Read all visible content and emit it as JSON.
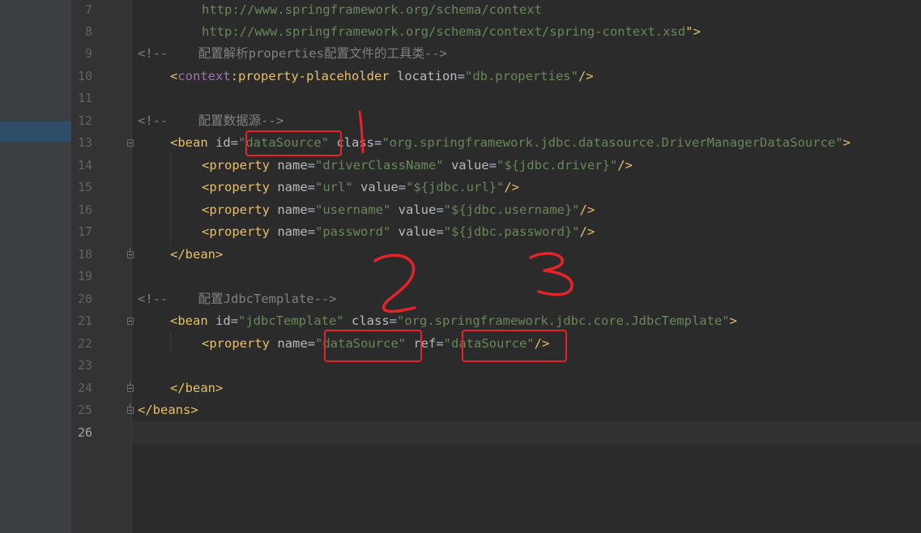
{
  "line_numbers": [
    "7",
    "8",
    "9",
    "10",
    "11",
    "12",
    "13",
    "14",
    "15",
    "16",
    "17",
    "18",
    "19",
    "20",
    "21",
    "22",
    "23",
    "24",
    "25",
    "26"
  ],
  "current_line": "26",
  "code": {
    "l7_value": "http://www.springframework.org/schema/context",
    "l8_value": "http://www.springframework.org/schema/context/spring-context.xsd",
    "l8_close": "\">",
    "l9_comment": "<!--    配置解析properties配置文件的工具类-->",
    "l10_open": "<",
    "l10_ns": "context",
    "l10_tag": ":property-placeholder ",
    "l10_attr": "location",
    "l10_eq": "=",
    "l10_val": "\"db.properties\"",
    "l10_close": "/>",
    "l12_comment": "<!--    配置数据源-->",
    "l13_tag": "<bean ",
    "l13_attr1": "id",
    "l13_eq1": "=",
    "l13_val1": "\"dataSource\"",
    "l13_attr2": " class",
    "l13_eq2": "=",
    "l13_val2": "\"org.springframework.jdbc.datasource.DriverManagerDataSource\"",
    "l13_close": ">",
    "props": [
      {
        "tag": "<property ",
        "a1": "name",
        "v1": "\"driverClassName\"",
        "a2": " value",
        "v2": "\"${jdbc.driver}\"",
        "close": "/>"
      },
      {
        "tag": "<property ",
        "a1": "name",
        "v1": "\"url\"",
        "a2": " value",
        "v2": "\"${jdbc.url}\"",
        "close": "/>"
      },
      {
        "tag": "<property ",
        "a1": "name",
        "v1": "\"username\"",
        "a2": " value",
        "v2": "\"${jdbc.username}\"",
        "close": "/>"
      },
      {
        "tag": "<property ",
        "a1": "name",
        "v1": "\"password\"",
        "a2": " value",
        "v2": "\"${jdbc.password}\"",
        "close": "/>"
      }
    ],
    "eq": "=",
    "l18_close": "</bean>",
    "l20_comment": "<!--    配置JdbcTemplate-->",
    "l21_tag": "<bean ",
    "l21_attr1": "id",
    "l21_val1": "\"jdbcTemplate\"",
    "l21_attr2": " class",
    "l21_val2": "\"org.springframework.jdbc.core.JdbcTemplate\"",
    "l21_close": ">",
    "l22_tag": "<property ",
    "l22_attr1": "name",
    "l22_val1": "\"dataSource\"",
    "l22_attr2": " ref",
    "l22_val2": "\"dataSource\"",
    "l22_close": "/>",
    "l24_close": "</bean>",
    "l25_close": "</beans>"
  },
  "annotation_colors": {
    "marker": "#e5242a"
  }
}
